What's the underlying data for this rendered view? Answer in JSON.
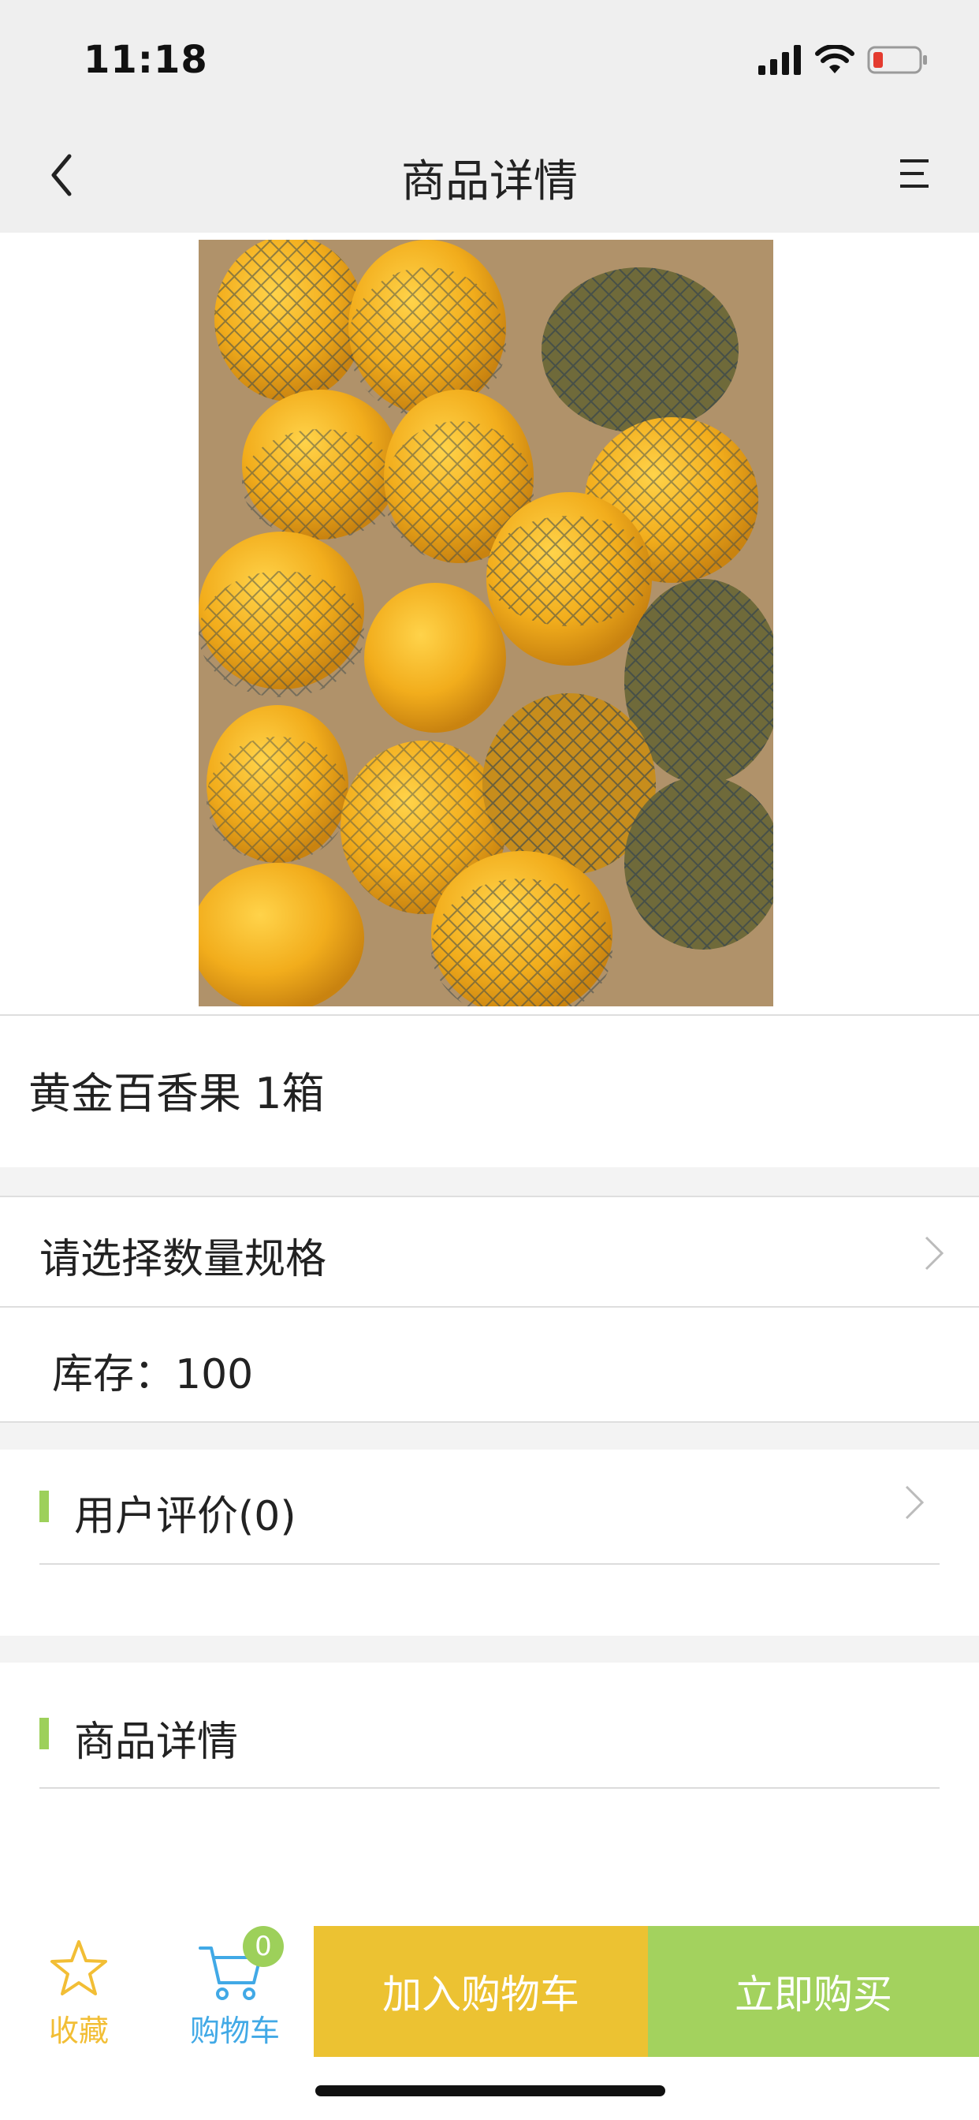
{
  "status_bar": {
    "time": "11:18"
  },
  "nav": {
    "title": "商品详情"
  },
  "product": {
    "name": "黄金百香果 1箱",
    "image_icon": "passion-fruit-photo"
  },
  "spec": {
    "label": "请选择数量规格"
  },
  "stock": {
    "label": "库存：",
    "value": "100"
  },
  "reviews": {
    "label": "用户评价(0)"
  },
  "details": {
    "label": "商品详情"
  },
  "bottom_bar": {
    "favorite_label": "收藏",
    "cart_label": "购物车",
    "cart_count": "0",
    "add_to_cart_label": "加入购物车",
    "buy_now_label": "立即购买"
  },
  "colors": {
    "accent_green": "#9dd05a",
    "accent_yellow": "#ecc232",
    "cart_blue": "#41a9e6"
  }
}
